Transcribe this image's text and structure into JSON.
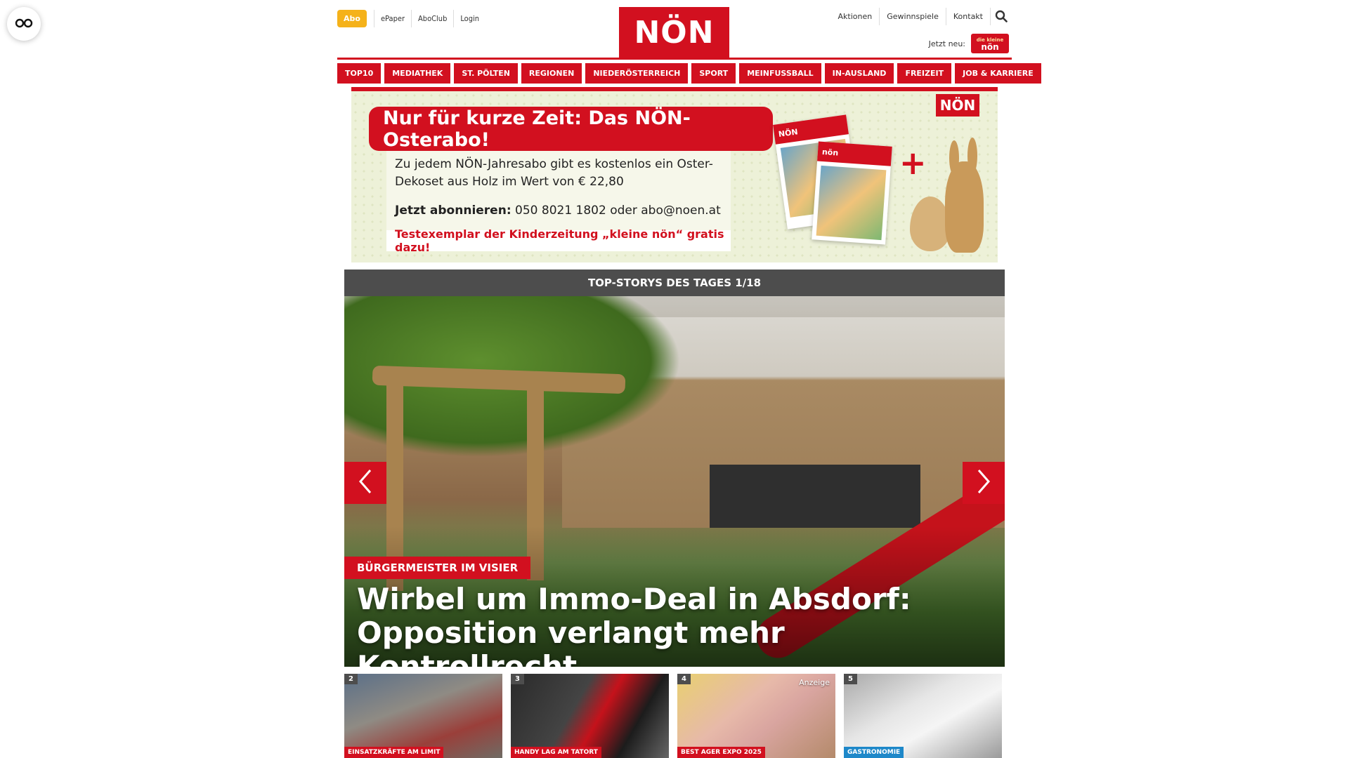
{
  "header": {
    "abo_label": "Abo",
    "left_links": [
      "ePaper",
      "AboClub",
      "Login"
    ],
    "logo_text": "NÖN",
    "right_links": [
      "Aktionen",
      "Gewinnspiele",
      "Kontakt"
    ],
    "jetzt_neu_label": "Jetzt neu:",
    "kleine_logo_top": "die kleine",
    "kleine_logo_main": "nön"
  },
  "nav": {
    "items": [
      "TOP10",
      "MEDIATHEK",
      "ST. PÖLTEN",
      "REGIONEN",
      "NIEDERÖSTERREICH",
      "SPORT",
      "MEINFUSSBALL",
      "IN-AUSLAND",
      "FREIZEIT",
      "JOB & KARRIERE"
    ]
  },
  "ad": {
    "headline": "Nur für kurze Zeit: Das NÖN-Osterabo!",
    "line1": "Zu jedem NÖN-Jahresabo gibt es kostenlos ein Oster-Dekoset aus Holz im Wert von € 22,80",
    "line2_bold": "Jetzt abonnieren:",
    "line2_rest": " 050 8021 1802 oder abo@noen.at",
    "line3": "Testexemplar der Kinderzeitung „kleine nön“ gratis dazu!",
    "logo_text": "NÖN",
    "mag_title": "NÖN",
    "mag_title2": "nön"
  },
  "stories": {
    "bar_title": "TOP-STORYS DES TAGES 1/18",
    "hero_kicker": "BÜRGERMEISTER IM VISIER",
    "hero_title": "Wirbel um Immo-Deal in Absdorf: Opposition verlangt mehr Kontrollrecht",
    "thumbs": [
      {
        "num": "2",
        "kicker": "EINSATZKRÄFTE AM LIMIT",
        "ad": ""
      },
      {
        "num": "3",
        "kicker": "HANDY LAG AM TATORT",
        "ad": ""
      },
      {
        "num": "4",
        "kicker": "BEST AGER EXPO 2025",
        "ad": "Anzeige"
      },
      {
        "num": "5",
        "kicker": "GASTRONOMIE",
        "ad": ""
      }
    ]
  },
  "colors": {
    "brand_red": "#d2101f",
    "abo_yellow": "#f5b21a",
    "bar_gray": "#4d4d4d",
    "gastro_blue": "#1e88c9"
  }
}
